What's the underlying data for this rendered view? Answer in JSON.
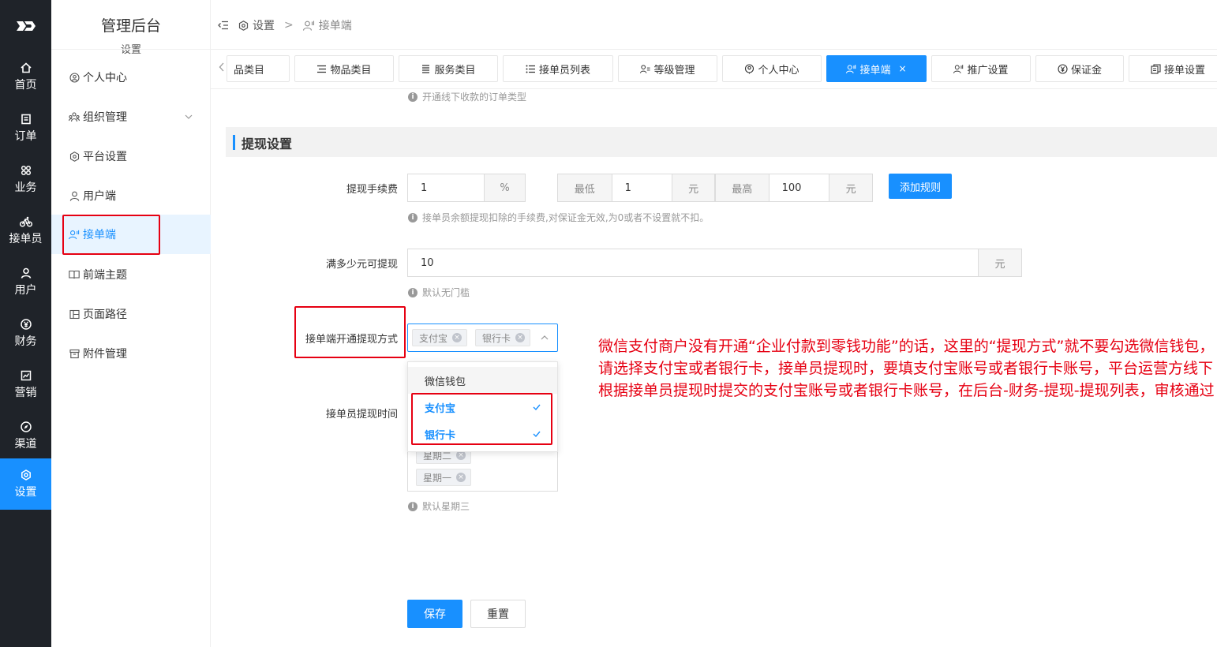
{
  "rail": {
    "items": [
      {
        "label": "首页",
        "icon": "home-icon"
      },
      {
        "label": "订单",
        "icon": "order-icon"
      },
      {
        "label": "业务",
        "icon": "grid-icon"
      },
      {
        "label": "接单员",
        "icon": "bike-icon"
      },
      {
        "label": "用户",
        "icon": "user-icon"
      },
      {
        "label": "财务",
        "icon": "yuan-icon"
      },
      {
        "label": "营销",
        "icon": "chart-icon"
      },
      {
        "label": "渠道",
        "icon": "compass-icon"
      },
      {
        "label": "设置",
        "icon": "gear-icon"
      }
    ],
    "active": "设置"
  },
  "sidebar": {
    "title": "管理后台",
    "subtitle": "设置",
    "items": [
      {
        "label": "个人中心"
      },
      {
        "label": "组织管理"
      },
      {
        "label": "平台设置"
      },
      {
        "label": "用户端"
      },
      {
        "label": "接单端"
      },
      {
        "label": "前端主题"
      },
      {
        "label": "页面路径"
      },
      {
        "label": "附件管理"
      }
    ]
  },
  "breadcrumb": {
    "root": "设置",
    "separator": ">",
    "current": "接单端"
  },
  "tabs": [
    {
      "label": "品类目"
    },
    {
      "label": "物品类目"
    },
    {
      "label": "服务类目"
    },
    {
      "label": "接单员列表"
    },
    {
      "label": "等级管理"
    },
    {
      "label": "个人中心"
    },
    {
      "label": "接单端",
      "close": "×"
    },
    {
      "label": "推广设置"
    },
    {
      "label": "保证金"
    },
    {
      "label": "接单设置"
    }
  ],
  "form": {
    "top_hint": "开通线下收款的订单类型",
    "section_title": "提现设置",
    "fee": {
      "label": "提现手续费",
      "value": "1",
      "unit": "%",
      "min_label": "最低",
      "min_value": "1",
      "min_unit": "元",
      "max_label": "最高",
      "max_value": "100",
      "max_unit": "元",
      "add_rule": "添加规则",
      "hint": "接单员余额提现扣除的手续费,对保证金无效,为0或者不设置就不扣。"
    },
    "threshold": {
      "label": "满多少元可提现",
      "value": "10",
      "unit": "元",
      "hint": "默认无门槛"
    },
    "methods": {
      "label": "接单端开通提现方式",
      "selected": [
        "支付宝",
        "银行卡"
      ],
      "options": [
        {
          "label": "微信钱包",
          "selected": false
        },
        {
          "label": "支付宝",
          "selected": true
        },
        {
          "label": "银行卡",
          "selected": true
        }
      ]
    },
    "withdraw_time": {
      "label": "接单员提现时间",
      "days": [
        "星期二",
        "星期一"
      ],
      "hint": "默认星期三"
    },
    "save": "保存",
    "reset": "重置"
  },
  "annotation": "微信支付商户没有开通“企业付款到零钱功能”的话，这里的“提现方式”就不要勾选微信钱包，请选择支付宝或者银行卡，接单员提现时，要填支付宝账号或者银行卡账号，平台运营方线下根据接单员提现时提交的支付宝账号或者银行卡账号，在后台-财务-提现-提现列表，审核通过",
  "colors": {
    "accent": "#1890ff",
    "rail_bg": "#1f2329",
    "annotation": "#e60012"
  }
}
